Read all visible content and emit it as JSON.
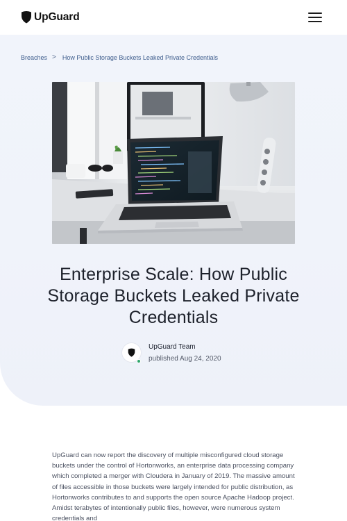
{
  "header": {
    "brand_name": "UpGuard",
    "logo_icon": "upguard-shield-icon",
    "menu_icon": "hamburger-menu-icon"
  },
  "breadcrumb": {
    "items": [
      {
        "label": "Breaches"
      },
      {
        "label": "How Public Storage Buckets Leaked Private Credentials"
      }
    ],
    "separator": ">"
  },
  "feature_image": {
    "description_icon": "laptop-desk-photo"
  },
  "article": {
    "title": "Enterprise Scale: How Public Storage Buckets Leaked Private Credentials",
    "author": {
      "name": "UpGuard Team",
      "published": "published Aug 24, 2020",
      "avatar_icon": "upguard-shield-icon",
      "status_color": "#2ea66b"
    },
    "body": "UpGuard can now report the discovery of multiple misconfigured cloud storage buckets under the control of Hortonworks, an enterprise data processing company which completed a merger with Cloudera in January of 2019. The massive amount of files accessible in those buckets were largely intended for public distribution, as Hortonworks contributes to and supports the open source Apache Hadoop project. Amidst terabytes of intentionally public files, however, were numerous system credentials and"
  },
  "colors": {
    "hero_background": "#f0f3fa",
    "breadcrumb_link": "#3d5c8c",
    "title_text": "#1d212b",
    "body_text": "#4a5060"
  }
}
